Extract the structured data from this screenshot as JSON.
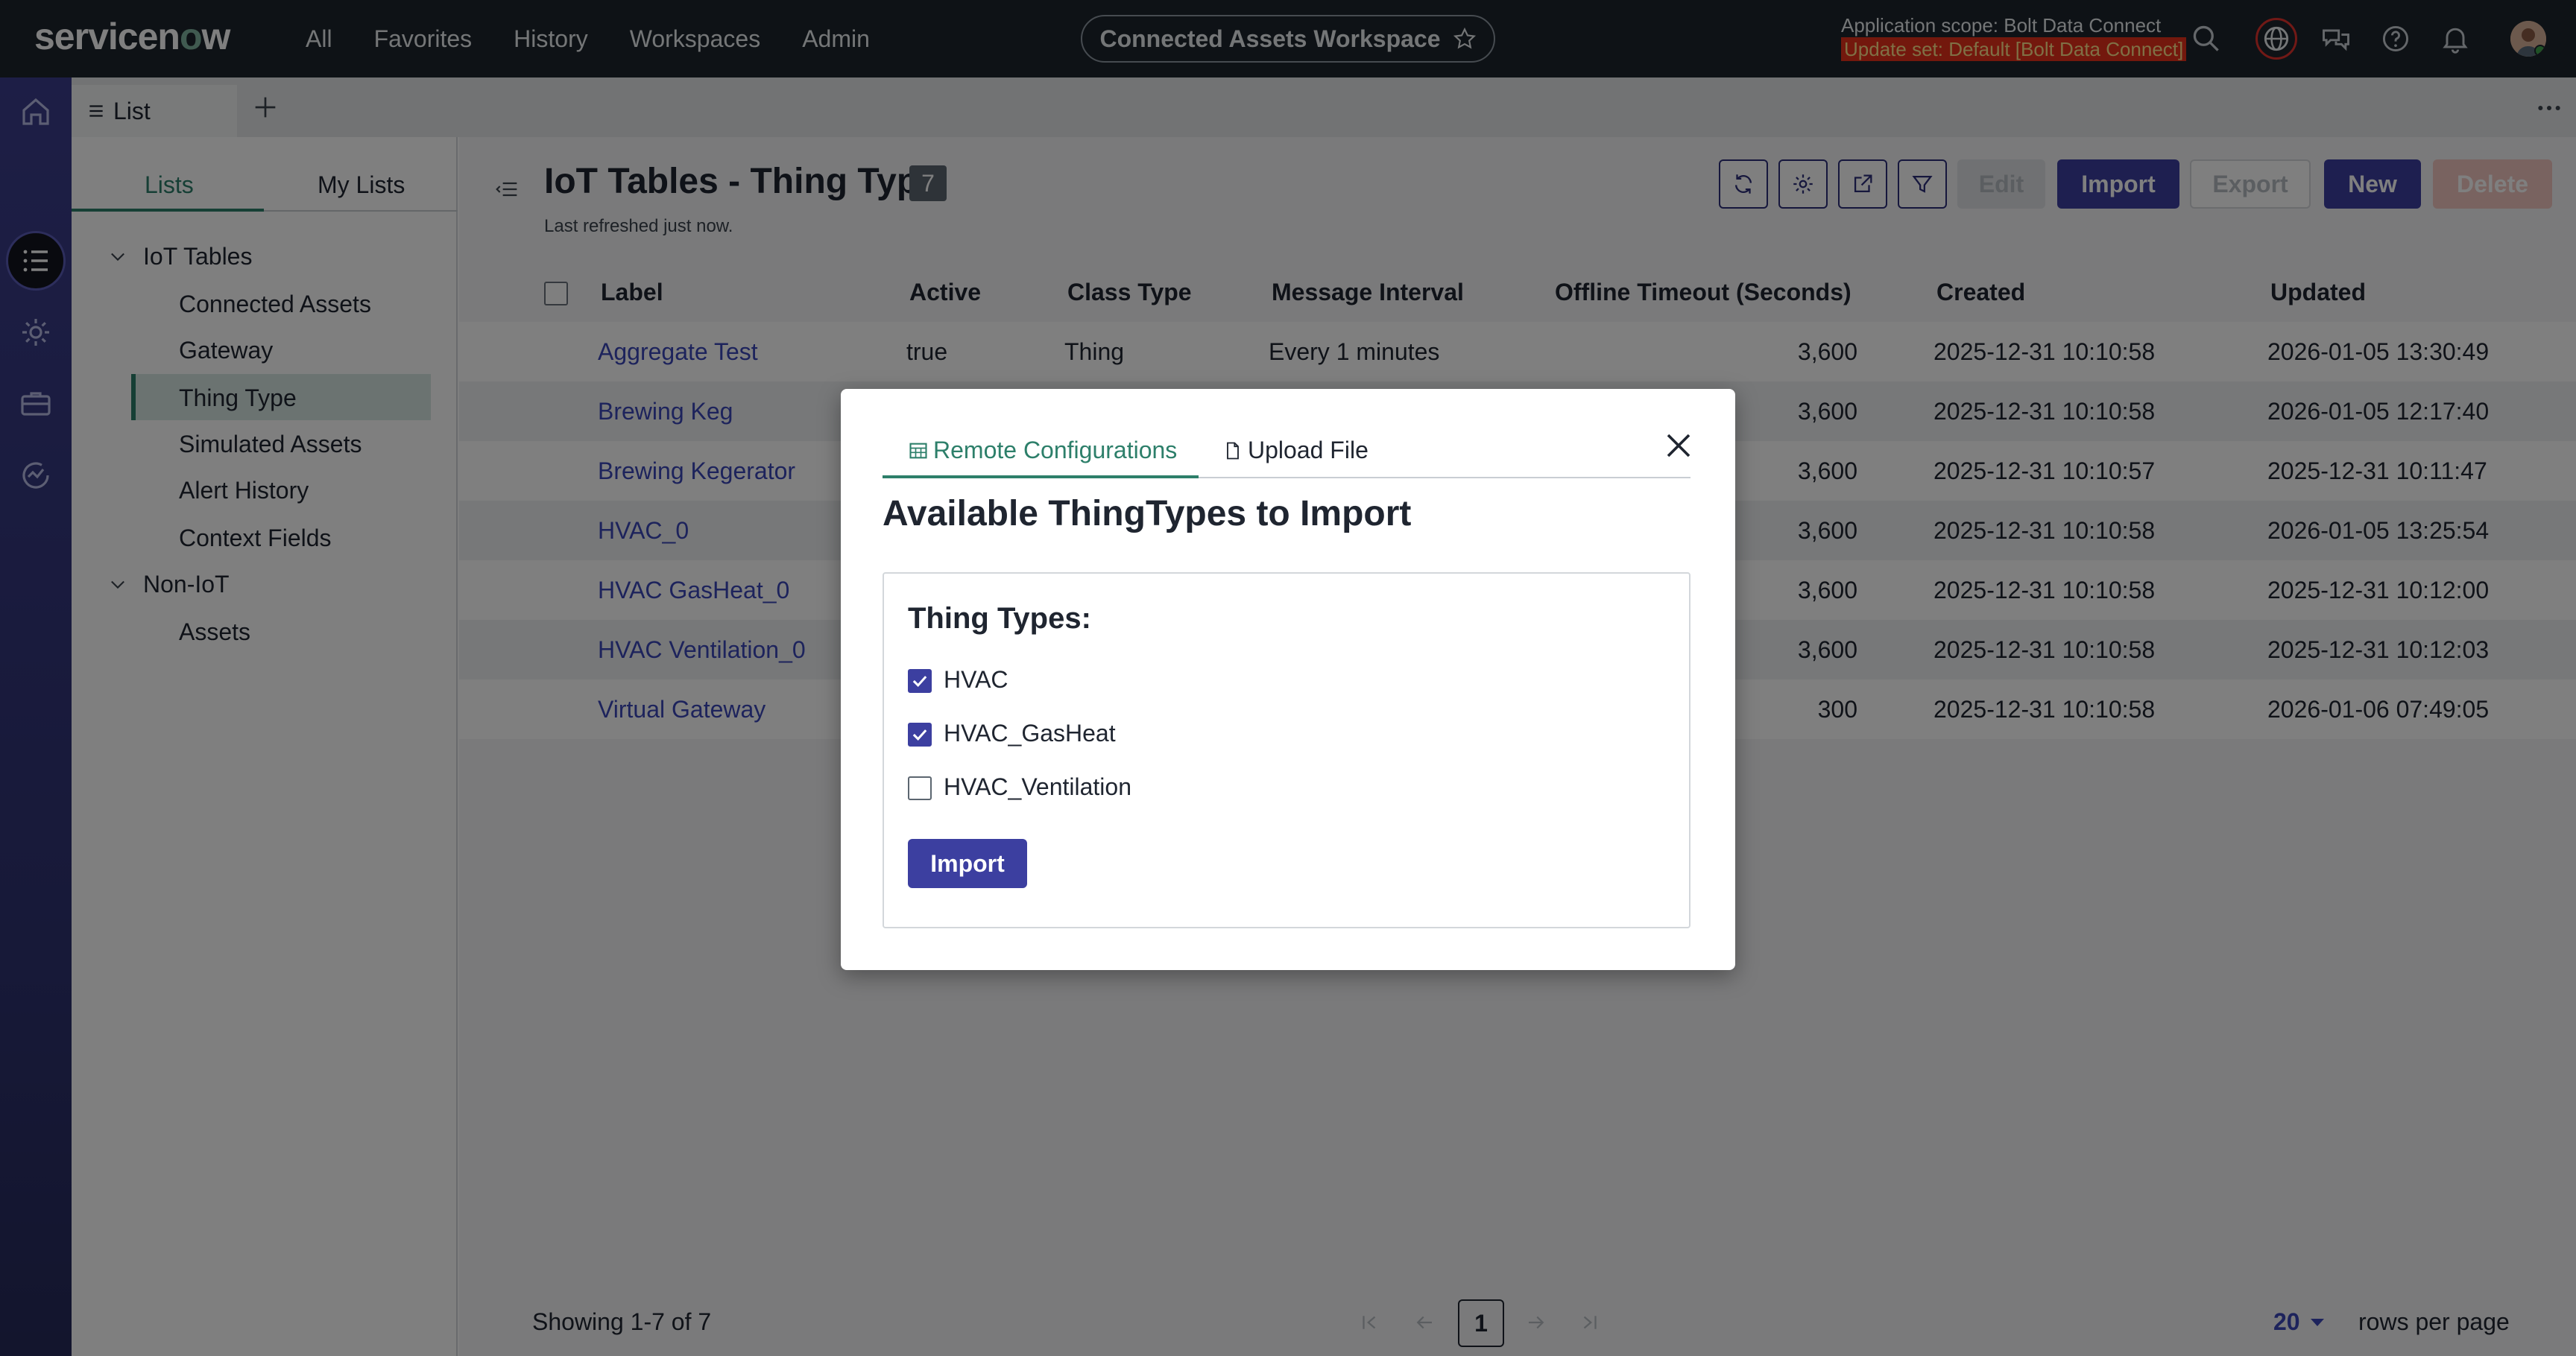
{
  "topnav": {
    "logo_prefix": "servicen",
    "logo_o": "o",
    "logo_suffix": "w",
    "menu": [
      "All",
      "Favorites",
      "History",
      "Workspaces",
      "Admin"
    ],
    "workspace": "Connected Assets Workspace",
    "scope_label": "Application scope: Bolt Data Connect",
    "update_set": "Update set: Default [Bolt Data Connect]",
    "icons": [
      "search-icon",
      "globe-icon",
      "chat-icon",
      "help-icon",
      "bell-icon"
    ]
  },
  "rail": {
    "icons": [
      "home-icon",
      "list-icon",
      "gear-icon",
      "briefcase-icon",
      "activity-icon"
    ]
  },
  "tabbar": {
    "tab_label": "List"
  },
  "leftpanel": {
    "tabs": [
      "Lists",
      "My Lists"
    ],
    "groups": [
      {
        "label": "IoT Tables",
        "items": [
          "Connected Assets",
          "Gateway",
          "Thing Type",
          "Simulated Assets",
          "Alert History",
          "Context Fields"
        ]
      },
      {
        "label": "Non-IoT",
        "items": [
          "Assets"
        ]
      }
    ],
    "selected": "Thing Type"
  },
  "main": {
    "title": "IoT Tables - Thing Type",
    "count": "7",
    "refreshed": "Last refreshed just now.",
    "buttons": {
      "edit": "Edit",
      "import": "Import",
      "export": "Export",
      "new": "New",
      "delete": "Delete"
    },
    "columns": [
      "Label",
      "Active",
      "Class Type",
      "Message Interval",
      "Offline Timeout (Seconds)",
      "Created",
      "Updated"
    ],
    "rows": [
      {
        "label": "Aggregate Test",
        "active": "true",
        "class_type": "Thing",
        "interval": "Every 1 minutes",
        "timeout": "3,600",
        "created": "2025-12-31 10:10:58",
        "updated": "2026-01-05 13:30:49"
      },
      {
        "label": "Brewing Keg",
        "active": "",
        "class_type": "",
        "interval": "",
        "timeout": "3,600",
        "created": "2025-12-31 10:10:58",
        "updated": "2026-01-05 12:17:40"
      },
      {
        "label": "Brewing Kegerator",
        "active": "",
        "class_type": "",
        "interval": "",
        "timeout": "3,600",
        "created": "2025-12-31 10:10:57",
        "updated": "2025-12-31 10:11:47"
      },
      {
        "label": "HVAC_0",
        "active": "",
        "class_type": "",
        "interval": "",
        "timeout": "3,600",
        "created": "2025-12-31 10:10:58",
        "updated": "2026-01-05 13:25:54"
      },
      {
        "label": "HVAC GasHeat_0",
        "active": "",
        "class_type": "",
        "interval": "",
        "timeout": "3,600",
        "created": "2025-12-31 10:10:58",
        "updated": "2025-12-31 10:12:00"
      },
      {
        "label": "HVAC Ventilation_0",
        "active": "",
        "class_type": "",
        "interval": "",
        "timeout": "3,600",
        "created": "2025-12-31 10:10:58",
        "updated": "2025-12-31 10:12:03"
      },
      {
        "label": "Virtual Gateway",
        "active": "",
        "class_type": "",
        "interval": "",
        "timeout": "300",
        "created": "2025-12-31 10:10:58",
        "updated": "2026-01-06 07:49:05"
      }
    ],
    "footer": {
      "showing": "Showing 1-7 of 7",
      "page": "1",
      "rows_per_page": "20",
      "rows_label": "rows per page"
    }
  },
  "modal": {
    "tabs": [
      "Remote Configurations",
      "Upload File"
    ],
    "title": "Available ThingTypes to Import",
    "box_title": "Thing Types:",
    "options": [
      {
        "label": "HVAC",
        "checked": true
      },
      {
        "label": "HVAC_GasHeat",
        "checked": true
      },
      {
        "label": "HVAC_Ventilation",
        "checked": false
      }
    ],
    "import_label": "Import"
  },
  "colors": {
    "nav_bg": "#1d252c",
    "accent": "#3c3fa0",
    "green": "#2d7f6a",
    "link": "#3a47b8",
    "update_set_bg": "#e7301b"
  }
}
